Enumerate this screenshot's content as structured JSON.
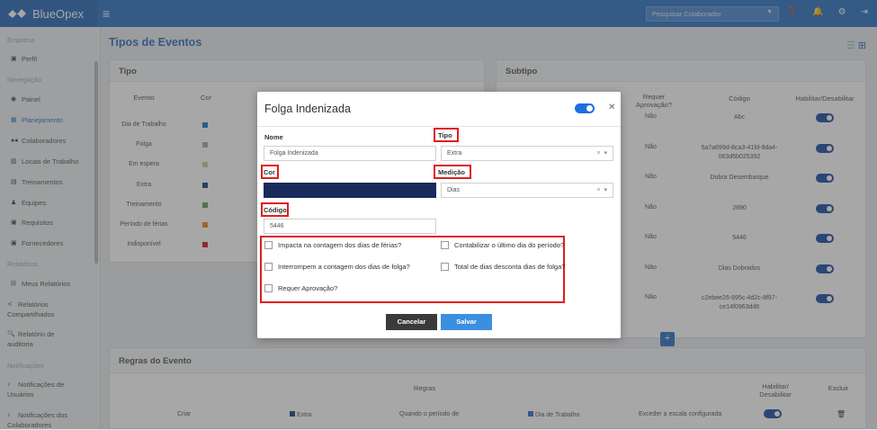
{
  "app": {
    "brand": "BlueOpex",
    "search_placeholder": "Pesquisar Colaborador"
  },
  "sidebar": {
    "section_empresa": "Empresa",
    "perfil": "Perfil",
    "section_nav": "Navegação",
    "painel": "Painel",
    "planejamento": "Planejamento",
    "colaboradores": "Colaboradores",
    "locais": "Locais de Trabalho",
    "treinamentos": "Treinamentos",
    "equipes": "Equipes",
    "requisitos": "Requisitos",
    "fornecedores": "Fornecedores",
    "section_relatorios": "Relatórios",
    "meus_relatorios": "Meus Relatórios",
    "rel_compart_1": "Relatórios",
    "rel_compart_2": "Compartilhados",
    "rel_auditoria_1": "Relatório de",
    "rel_auditoria_2": "auditoria",
    "section_notif": "Notificações",
    "notif_usuarios_1": "Notificações de",
    "notif_usuarios_2": "Usuários",
    "notif_colab_1": "Notificações dos",
    "notif_colab_2": "Colaboradores"
  },
  "page": {
    "title": "Tipos de Eventos"
  },
  "tipo_panel": {
    "title": "Tipo",
    "col_evento": "Evento",
    "col_cor": "Cor",
    "rows": [
      {
        "evento": "Dia de Trabalho",
        "color": "#2f74c4"
      },
      {
        "evento": "Folga",
        "color": "#aaaaaa"
      },
      {
        "evento": "Em espera",
        "color": "#c9cfa4"
      },
      {
        "evento": "Extra",
        "color": "#1d3f85"
      },
      {
        "evento": "Treinamento",
        "color": "#5aa84a"
      },
      {
        "evento": "Período de férias",
        "color": "#e8892b"
      },
      {
        "evento": "Indisponível",
        "color": "#d92020"
      }
    ]
  },
  "subtipo_panel": {
    "title": "Subtipo",
    "col_requer_1": "Requer",
    "col_requer_2": "Aprovação?",
    "col_codigo": "Código",
    "col_habilitar": "Habilitar/Desabilitar",
    "rows": [
      {
        "requer": "Não",
        "codigo_1": "Abc",
        "codigo_2": ""
      },
      {
        "requer": "Não",
        "codigo_1": "5a7a699d-8ca3-41fd-9da4-",
        "codigo_2": "063d6b025392"
      },
      {
        "requer": "Não",
        "codigo_1": "Dobra Desembarque",
        "codigo_2": ""
      },
      {
        "requer": "Não",
        "codigo_1": "2890",
        "codigo_2": ""
      },
      {
        "requer": "Não",
        "codigo_1": "5446",
        "codigo_2": ""
      },
      {
        "requer": "Não",
        "codigo_1": "Dias Dobrados",
        "codigo_2": ""
      },
      {
        "requer": "Não",
        "codigo_1": "c2ebee26-995c-4d2c-8f97-",
        "codigo_2": "ce14f0963dd8"
      }
    ]
  },
  "regras_panel": {
    "title": "Regras do Evento",
    "col_regras": "Regras",
    "col_habilitar_1": "Habilitar/",
    "col_habilitar_2": "Desabilitar",
    "col_excluir": "Excluir",
    "row": {
      "acao": "Criar",
      "tipo": "Extra",
      "quando": "Quando o período de",
      "evento": "Dia de Trabalho",
      "condicao": "Exceder a escala configurada"
    }
  },
  "modal": {
    "title": "Folga Indenizada",
    "nome_label": "Nome",
    "nome_value": "Folga Indenizada",
    "tipo_label": "Tipo",
    "tipo_value": "Extra",
    "cor_label": "Cor",
    "cor_value": "#1b2a5c",
    "medicao_label": "Medição",
    "medicao_value": "Dias",
    "codigo_label": "Código",
    "codigo_value": "5446",
    "cb_ferias": "Impacta na contagem dos dias de férias?",
    "cb_ultimo_dia": "Contabilizar o último dia do período?",
    "cb_folga": "Interrompem a contagem dos dias de folga?",
    "cb_total_dias": "Total de dias desconta dias de folga?",
    "cb_aprovacao": "Requer Aprovação?",
    "cancel_label": "Cancelar",
    "save_label": "Salvar"
  }
}
